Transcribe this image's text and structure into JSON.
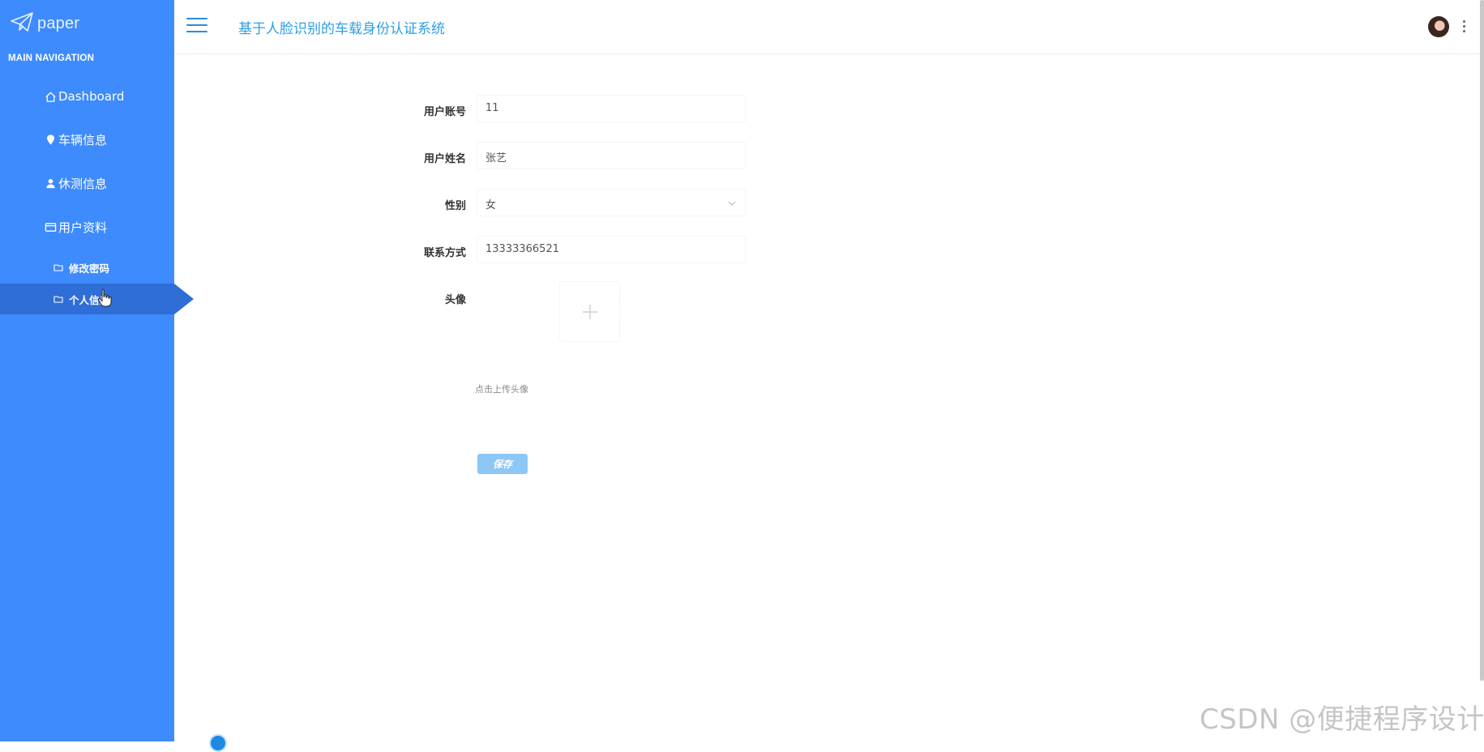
{
  "sidebar": {
    "logo_text": "paper",
    "heading": "MAIN NAVIGATION",
    "items": [
      {
        "label": "Dashboard",
        "icon": "home-icon"
      },
      {
        "label": "车辆信息",
        "icon": "location-pin-icon"
      },
      {
        "label": "休测信息",
        "icon": "user-icon"
      },
      {
        "label": "用户资料",
        "icon": "card-icon",
        "expanded": true,
        "children": [
          {
            "label": "修改密码",
            "icon": "folder-icon"
          },
          {
            "label": "个人信息",
            "icon": "folder-icon",
            "active": true
          }
        ]
      }
    ]
  },
  "header": {
    "title": "基于人脸识别的车载身份认证系统"
  },
  "form": {
    "account": {
      "label": "用户账号",
      "value": "11"
    },
    "name": {
      "label": "用户姓名",
      "value": "张艺"
    },
    "gender": {
      "label": "性别",
      "value": "女"
    },
    "contact": {
      "label": "联系方式",
      "value": "13333366521"
    },
    "avatar": {
      "label": "头像",
      "tip": "点击上传头像"
    },
    "save_label": "保存"
  },
  "watermark": "CSDN @便捷程序设计",
  "colors": {
    "sidebar_bg": "#3d8bfd",
    "sidebar_active": "#2f6ed6",
    "title": "#2c9ee6",
    "save_button": "#8cc7f5"
  }
}
